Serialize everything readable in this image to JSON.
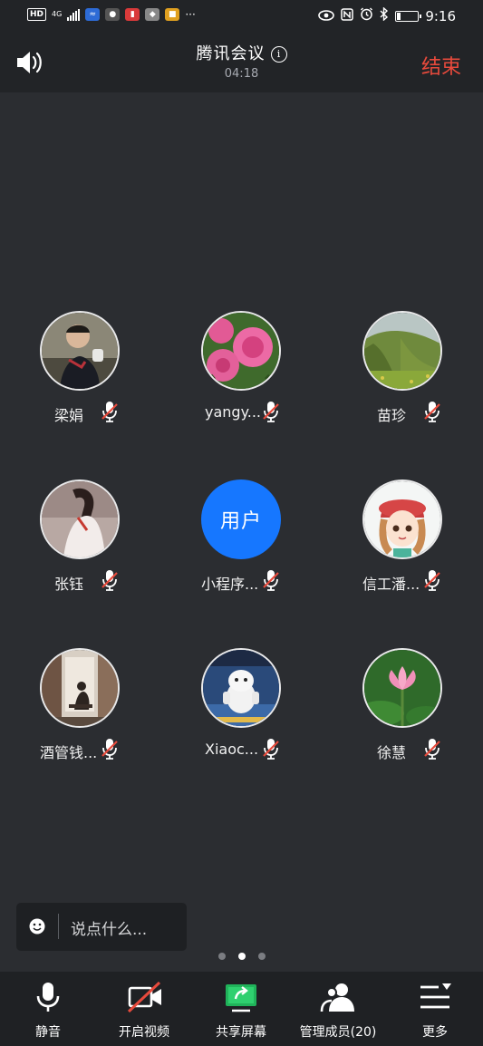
{
  "status_bar": {
    "hd": "HD",
    "network": "4G",
    "time": "9:16",
    "overflow": "···",
    "icons": [
      "eye-icon",
      "nfc-icon",
      "alarm-icon",
      "bluetooth-icon",
      "battery-icon"
    ],
    "battery_level": 0.2
  },
  "header": {
    "title": "腾讯会议",
    "timer": "04:18",
    "end_label": "结束"
  },
  "participants": [
    {
      "name": "梁娟",
      "muted": true
    },
    {
      "name": "yangy...",
      "muted": true
    },
    {
      "name": "苗珍",
      "muted": true
    },
    {
      "name": "张钰",
      "muted": true
    },
    {
      "name": "小程序...",
      "muted": true,
      "avatar_text": "用户",
      "avatar_color": "#1677ff"
    },
    {
      "name": "信工潘...",
      "muted": true
    },
    {
      "name": "酒管钱...",
      "muted": true
    },
    {
      "name": "Xiaoc...",
      "muted": true
    },
    {
      "name": "徐慧",
      "muted": true
    }
  ],
  "chat": {
    "placeholder": "说点什么..."
  },
  "pagination": {
    "total": 3,
    "current": 2
  },
  "toolbar": {
    "mute": "静音",
    "video": "开启视频",
    "share": "共享屏幕",
    "members": "管理成员(20)",
    "more": "更多"
  },
  "colors": {
    "background": "#2b2d31",
    "bar": "#222427",
    "end": "#e84a3c",
    "accent_blue": "#1677ff",
    "share_green": "#20b35a",
    "mute_red": "#e84a3c"
  }
}
